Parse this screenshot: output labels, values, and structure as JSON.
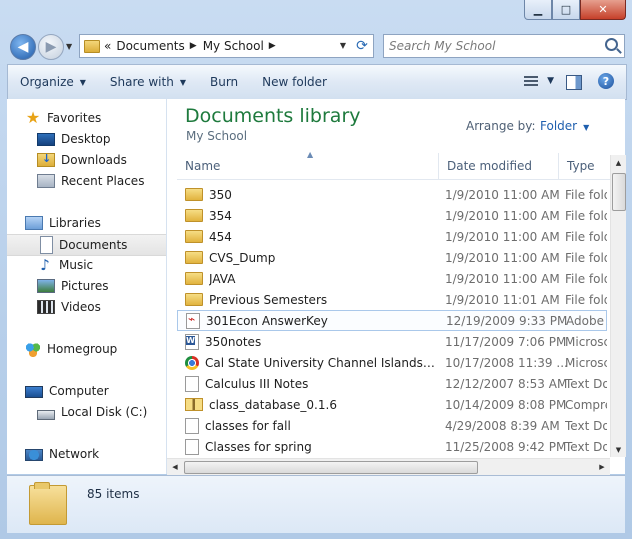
{
  "window": {
    "controls": {
      "minimize": "▁",
      "maximize": "□",
      "close": "✕"
    }
  },
  "addressbar": {
    "overflow": "«",
    "crumbs": [
      "Documents",
      "My School"
    ],
    "separator": "▶",
    "dropdown": "▼",
    "refresh": "⟳"
  },
  "nav": {
    "back": "◀",
    "forward": "▶",
    "history": "▼"
  },
  "search": {
    "placeholder": "Search My School"
  },
  "toolbar": {
    "organize": "Organize",
    "share_with": "Share with",
    "burn": "Burn",
    "new_folder": "New folder",
    "caret": "▼",
    "help": "?"
  },
  "sidebar": {
    "favorites": "Favorites",
    "desktop": "Desktop",
    "downloads": "Downloads",
    "recent_places": "Recent Places",
    "libraries": "Libraries",
    "documents": "Documents",
    "music": "Music",
    "pictures": "Pictures",
    "videos": "Videos",
    "homegroup": "Homegroup",
    "computer": "Computer",
    "local_disk": "Local Disk (C:)",
    "network": "Network"
  },
  "library": {
    "title": "Documents library",
    "subtitle": "My School",
    "arrange_label": "Arrange by:",
    "arrange_value": "Folder"
  },
  "columns": {
    "name": "Name",
    "date": "Date modified",
    "type": "Type",
    "sort_indicator": "▲"
  },
  "files": [
    {
      "name": "350",
      "date": "1/9/2010 11:00 AM",
      "type": "File fold",
      "icon": "folder"
    },
    {
      "name": "354",
      "date": "1/9/2010 11:00 AM",
      "type": "File fold",
      "icon": "folder"
    },
    {
      "name": "454",
      "date": "1/9/2010 11:00 AM",
      "type": "File fold",
      "icon": "folder"
    },
    {
      "name": "CVS_Dump",
      "date": "1/9/2010 11:00 AM",
      "type": "File fold",
      "icon": "folder"
    },
    {
      "name": "JAVA",
      "date": "1/9/2010 11:00 AM",
      "type": "File fold",
      "icon": "folder"
    },
    {
      "name": "Previous Semesters",
      "date": "1/9/2010 11:01 AM",
      "type": "File fold",
      "icon": "folder"
    },
    {
      "name": "301Econ AnswerKey",
      "date": "12/19/2009 9:33 PM",
      "type": "Adobe A",
      "icon": "pdf"
    },
    {
      "name": "350notes",
      "date": "11/17/2009 7:06 PM",
      "type": "Microsc",
      "icon": "word"
    },
    {
      "name": "Cal State University Channel Islands Tran...",
      "date": "10/17/2008 11:39 ...",
      "type": "Microsc",
      "icon": "chrome"
    },
    {
      "name": "Calculus III Notes",
      "date": "12/12/2007 8:53 AM",
      "type": "Text Do",
      "icon": "text"
    },
    {
      "name": "class_database_0.1.6",
      "date": "10/14/2009 8:08 PM",
      "type": "Compre",
      "icon": "zip"
    },
    {
      "name": "classes for fall",
      "date": "4/29/2008 8:39 AM",
      "type": "Text Do",
      "icon": "text"
    },
    {
      "name": "Classes for spring",
      "date": "11/25/2008 9:42 PM",
      "type": "Text Do",
      "icon": "text"
    }
  ],
  "scroll": {
    "up": "▲",
    "down": "▼",
    "left": "◀",
    "right": "▶"
  },
  "details": {
    "count": "85 items"
  },
  "colors": {
    "library_title": "#1e7a3d",
    "link": "#1f5fae",
    "chrome": "#bcd4ee"
  }
}
